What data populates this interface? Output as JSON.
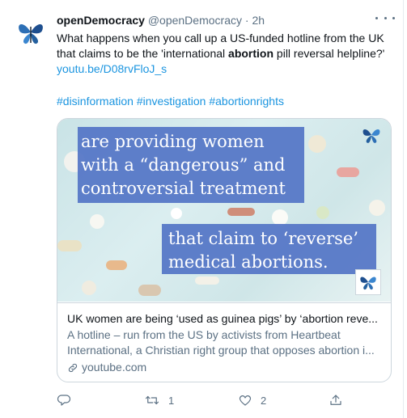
{
  "tweet": {
    "name": "openDemocracy",
    "handle": "@openDemocracy",
    "dot": "·",
    "time": "2h",
    "text_part1": "What happens when you call up a US-funded hotline from the UK that claims to be the 'international ",
    "text_bold": "abortion",
    "text_part2": " pill reversal helpline?' ",
    "text_link": "youtu.be/D08rvFloJ_s",
    "hashtags": [
      "#disinformation",
      "#investigation",
      "#abortionrights"
    ]
  },
  "card": {
    "image_quote1": "are providing women with a “dangerous” and controversial treatment",
    "image_quote2": "that claim to ‘reverse’ medical abortions.",
    "title": "UK women are being ‘used as guinea pigs’ by ‘abortion reve...",
    "description": "A hotline – run from the US by activists from Heartbeat International, a Christian right group that opposes abortion i...",
    "domain": "youtube.com"
  },
  "actions": {
    "reply_count": "",
    "retweet_count": "1",
    "like_count": "2",
    "icons": [
      "reply-icon",
      "retweet-icon",
      "like-icon",
      "share-icon"
    ]
  },
  "colors": {
    "link": "#1b95e0",
    "secondary": "#5b7083",
    "quote_box": "#5374c6"
  }
}
